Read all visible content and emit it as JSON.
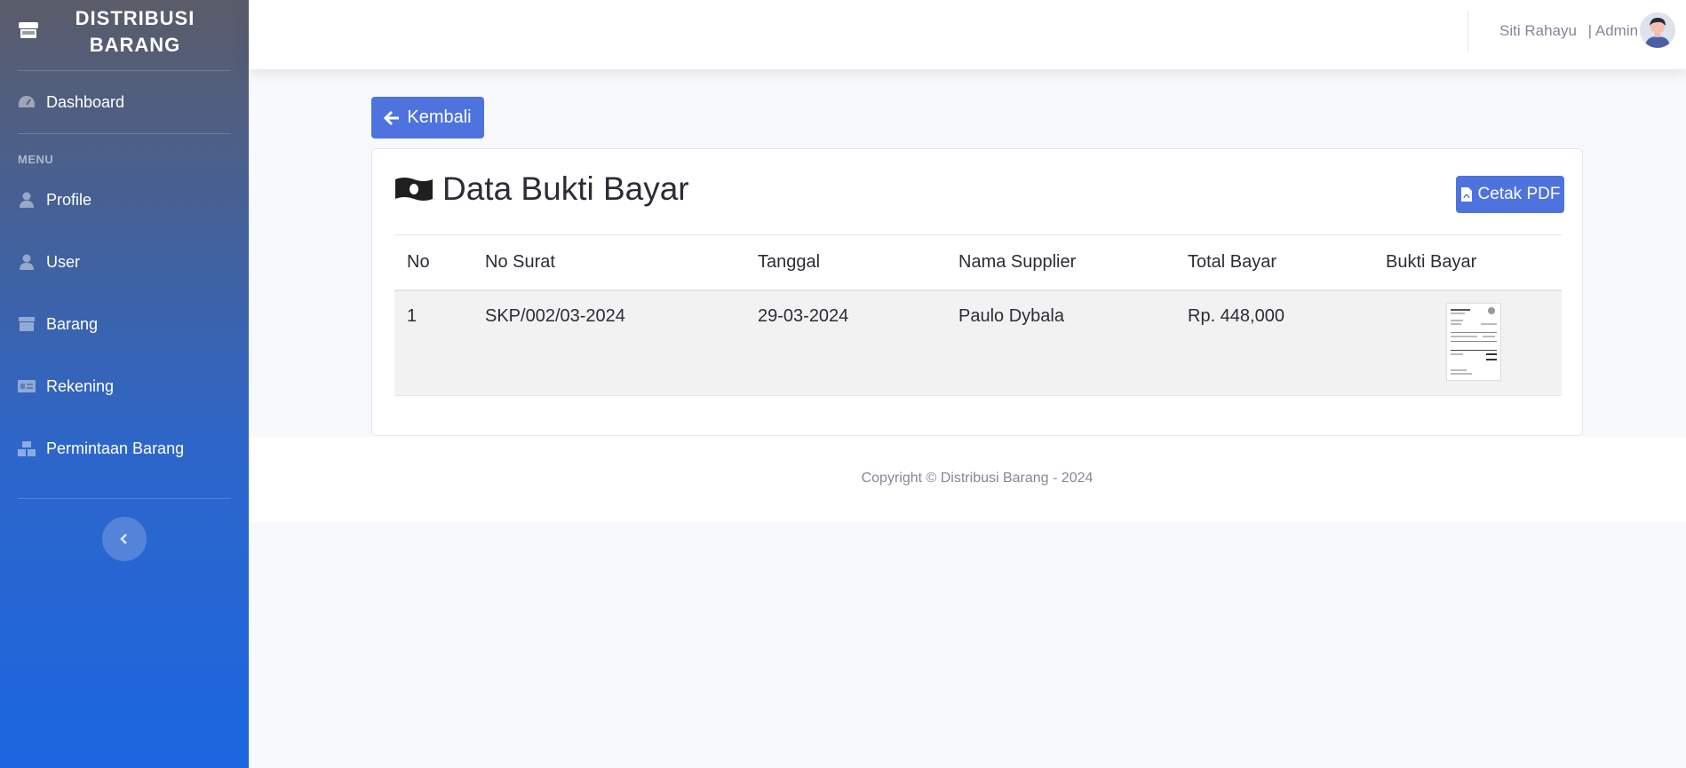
{
  "brand": {
    "name": "DISTRIBUSI BARANG",
    "icon": "store-icon"
  },
  "sidebar": {
    "dashboard": {
      "label": "Dashboard",
      "icon": "tachometer-icon"
    },
    "menu_heading": "MENU",
    "items": [
      {
        "label": "Profile",
        "icon": "user-icon"
      },
      {
        "label": "User",
        "icon": "user-icon"
      },
      {
        "label": "Barang",
        "icon": "box-icon"
      },
      {
        "label": "Rekening",
        "icon": "id-card-icon"
      },
      {
        "label": "Permintaan Barang",
        "icon": "boxes-icon"
      }
    ],
    "toggle_icon": "chevron-left-icon"
  },
  "topbar": {
    "user_name": "Siti Rahayu",
    "role": "| Admin"
  },
  "main": {
    "back_button": "Kembali",
    "card_title": "Data Bukti Bayar",
    "pdf_button": "Cetak PDF",
    "table": {
      "headers": [
        "No",
        "No Surat",
        "Tanggal",
        "Nama Supplier",
        "Total Bayar",
        "Bukti Bayar"
      ],
      "rows": [
        {
          "no": "1",
          "no_surat": "SKP/002/03-2024",
          "tanggal": "29-03-2024",
          "supplier": "Paulo Dybala",
          "total": "Rp. 448,000"
        }
      ]
    }
  },
  "footer": {
    "copyright": "Copyright © Distribusi Barang - 2024"
  },
  "colors": {
    "primary": "#4e73df",
    "sidebar_top": "#5a5c69",
    "sidebar_bottom": "#1b66e0"
  }
}
